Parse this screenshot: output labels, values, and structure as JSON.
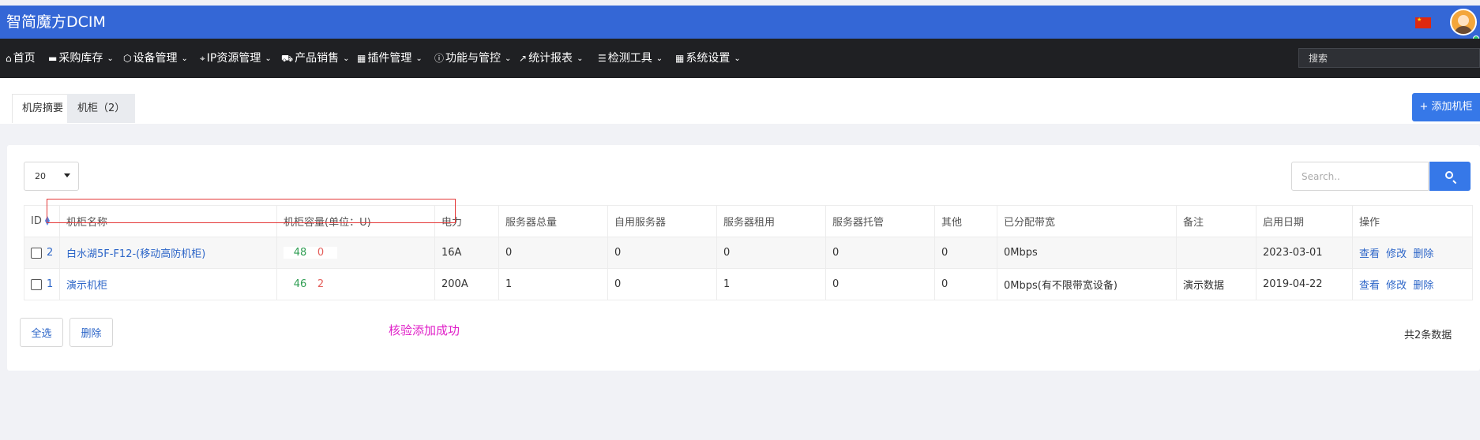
{
  "app": {
    "title": "智简魔方DCIM"
  },
  "nav": {
    "items": [
      {
        "label": "首页",
        "icon": "home-icon",
        "glyph": "⌂",
        "caret": false
      },
      {
        "label": "采购库存",
        "icon": "inventory-icon",
        "glyph": "▬",
        "caret": true
      },
      {
        "label": "设备管理",
        "icon": "cube-icon",
        "glyph": "⬡",
        "caret": true
      },
      {
        "label": "IP资源管理",
        "icon": "map-marker-icon",
        "glyph": "⌖",
        "caret": true
      },
      {
        "label": "产品销售",
        "icon": "cart-icon",
        "glyph": "⛟",
        "caret": true
      },
      {
        "label": "插件管理",
        "icon": "grid-icon",
        "glyph": "▦",
        "caret": true
      },
      {
        "label": "功能与管控",
        "icon": "info-icon",
        "glyph": "ⓘ",
        "caret": true
      },
      {
        "label": "统计报表",
        "icon": "line-chart-icon",
        "glyph": "↗",
        "caret": true
      },
      {
        "label": "检测工具",
        "icon": "list-icon",
        "glyph": "☰",
        "caret": true
      },
      {
        "label": "系统设置",
        "icon": "apps-icon",
        "glyph": "▦",
        "caret": true
      }
    ],
    "search_placeholder": "搜索"
  },
  "tabs": [
    {
      "label": "机房摘要",
      "active": true
    },
    {
      "label": "机柜（2）",
      "active": false
    }
  ],
  "actions": {
    "add_cabinet": "+ 添加机柜"
  },
  "controls": {
    "page_size": "20",
    "search_placeholder": "Search.."
  },
  "table": {
    "headers": [
      "ID",
      "机柜名称",
      "机柜容量(单位：U)",
      "电力",
      "服务器总量",
      "自用服务器",
      "服务器租用",
      "服务器托管",
      "其他",
      "已分配带宽",
      "备注",
      "启用日期",
      "操作"
    ],
    "rows": [
      {
        "id": "2",
        "name": "白水湖5F-F12-(移动高防机柜)",
        "capacity_used": "48",
        "capacity_other": "0",
        "power": "16A",
        "server_total": "0",
        "self_use": "0",
        "rental": "0",
        "hosting": "0",
        "other": "0",
        "bandwidth": "0Mbps",
        "note": "",
        "start_date": "2023-03-01",
        "actions": [
          "查看",
          "修改",
          "删除"
        ]
      },
      {
        "id": "1",
        "name": "演示机柜",
        "capacity_used": "46",
        "capacity_other": "2",
        "power": "200A",
        "server_total": "1",
        "self_use": "0",
        "rental": "1",
        "hosting": "0",
        "other": "0",
        "bandwidth": "0Mbps(有不限带宽设备)",
        "note": "演示数据",
        "start_date": "2019-04-22",
        "actions": [
          "查看",
          "修改",
          "删除"
        ]
      }
    ]
  },
  "footer": {
    "select_all": "全选",
    "delete": "删除",
    "message": "核验添加成功",
    "total": "共2条数据"
  },
  "colors": {
    "header": "#3467d6",
    "nav": "#1f2023",
    "accent": "#3678e8",
    "link": "#2d66c8",
    "green": "#2e9d52",
    "red": "#e45f5b",
    "message": "#e020c8"
  }
}
